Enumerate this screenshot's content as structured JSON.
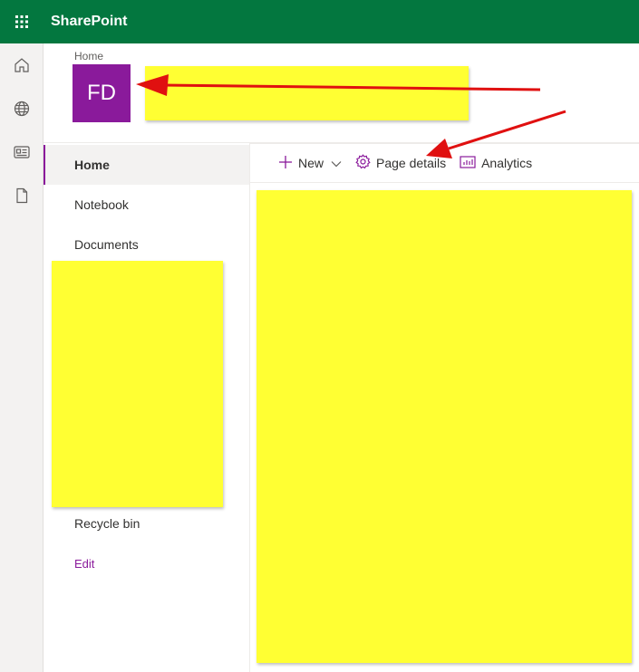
{
  "suite_bar": {
    "brand": "SharePoint"
  },
  "app_bar": {
    "icons": [
      "home-icon",
      "globe-icon",
      "news-icon",
      "document-icon"
    ]
  },
  "header": {
    "breadcrumb": "Home",
    "site_initials": "FD"
  },
  "left_nav": {
    "items": [
      {
        "label": "Home",
        "selected": true
      },
      {
        "label": "Notebook"
      },
      {
        "label": "Documents"
      },
      {
        "label": "Recycle bin"
      }
    ],
    "edit_label": "Edit"
  },
  "command_bar": {
    "new_label": "New",
    "page_details_label": "Page details",
    "analytics_label": "Analytics"
  },
  "colors": {
    "suite_bar": "#03773f",
    "site_logo": "#8a1a9b",
    "redaction": "#ffff33",
    "annotation_arrow": "#e01010"
  }
}
